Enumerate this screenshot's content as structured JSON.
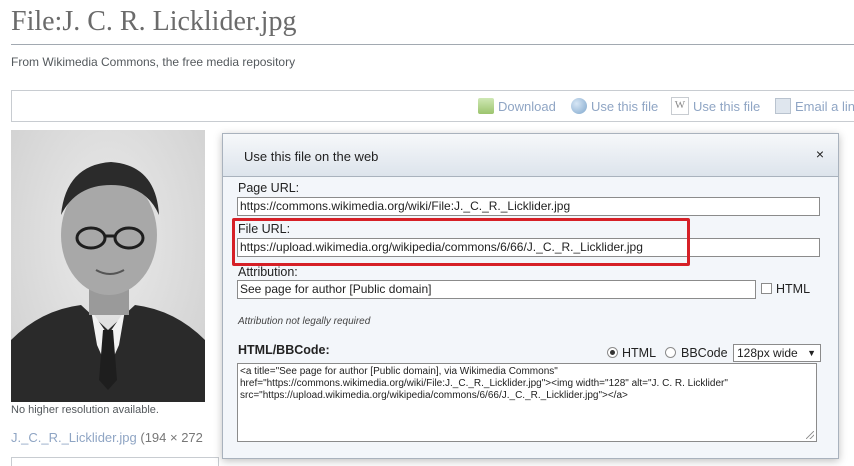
{
  "page": {
    "title": "File:J. C. R. Licklider.jpg",
    "subtitle": "From Wikimedia Commons, the free media repository"
  },
  "toolbar": {
    "download": "Download",
    "use_this_file": "Use this file",
    "use_this_file_wiki": "Use this file",
    "email_link": "Email a lin"
  },
  "image_panel": {
    "no_hires": "No higher resolution available.",
    "file_name": "J._C._R._Licklider.jpg",
    "dimensions": "(194 × 272"
  },
  "dialog": {
    "title": "Use this file on the web",
    "close": "×",
    "page_url_label": "Page URL:",
    "page_url": "https://commons.wikimedia.org/wiki/File:J._C._R._Licklider.jpg",
    "file_url_label": "File URL:",
    "file_url": "https://upload.wikimedia.org/wikipedia/commons/6/66/J._C._R._Licklider.jpg",
    "attribution_label": "Attribution:",
    "attribution": "See page for author [Public domain]",
    "attribution_html_label": "HTML",
    "attribution_note": "Attribution not legally required",
    "html_bbcode_label": "HTML/BBCode:",
    "radio_html": "HTML",
    "radio_bbcode": "BBCode",
    "size_select": "128px wide",
    "code_line1": "<a title=\"See page for author [Public domain], via Wikimedia Commons\"",
    "code_line2": "href=\"https://commons.wikimedia.org/wiki/File:J._C._R._Licklider.jpg\"><img width=\"128\" alt=\"J. C. R. Licklider\"",
    "code_line3": "src=\"https://upload.wikimedia.org/wikipedia/commons/6/66/J._C._R._Licklider.jpg\"></a>"
  },
  "colors": {
    "highlight": "#d62027",
    "link": "#8fa5c4"
  }
}
